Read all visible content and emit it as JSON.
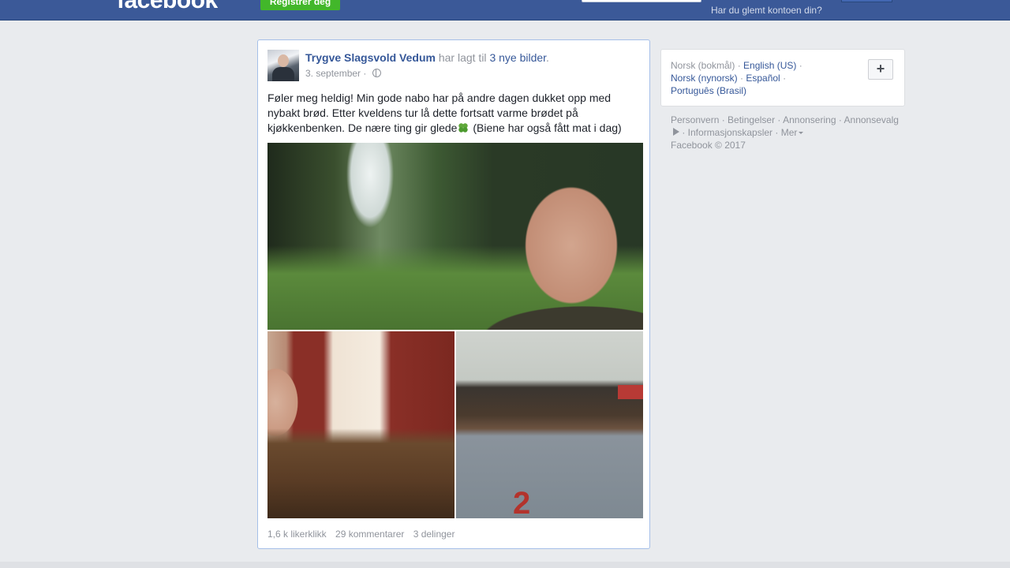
{
  "topbar": {
    "logo": "facebook",
    "register_label": "Registrer deg",
    "forgot_label": "Har du glemt kontoen din?"
  },
  "post": {
    "author": "Trygve Slagsvold Vedum",
    "action_text": " har lagt til ",
    "photos_link": "3 nye bilder",
    "period": ".",
    "date": "3. september",
    "meta_sep": " ·",
    "text_before": "Føler meg heldig! Min gode nabo har på andre dagen dukket opp med nybakt brød. Etter kveldens tur lå dette fortsatt varme brødet på kjøkkenbenken. De nære ting gir glede",
    "text_after": " (Biene har også fått mat i dag)",
    "stats": {
      "likes": "1,6 k likerklikk",
      "comments": "29 kommentarer",
      "shares": "3 delinger"
    }
  },
  "languages": {
    "current": "Norsk (bokmål)",
    "items": [
      "English (US)",
      "Norsk (nynorsk)",
      "Español",
      "Português (Brasil)"
    ],
    "add_label": "+"
  },
  "footer": {
    "links": [
      "Personvern",
      "Betingelser",
      "Annonsering",
      "Annonsevalg",
      "Informasjonskapsler",
      "Mer"
    ],
    "copyright": "Facebook © 2017"
  }
}
